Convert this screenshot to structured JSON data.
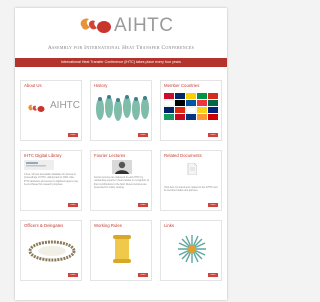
{
  "header": {
    "logo_text": "AIHTC",
    "tagline": "Assembly for International Heat Transfer Conferences",
    "banner": "International Heat Transfer Conference (IHTC) takes place every four years"
  },
  "cards": [
    {
      "title": "About Us",
      "button": "more",
      "logo_text": "AIHTC"
    },
    {
      "title": "History",
      "button": "more"
    },
    {
      "title": "Member Countries",
      "button": "more"
    },
    {
      "title": "IHTC Digital Library",
      "button": "more",
      "text": "A free, full text accessible database for access to proceedings of IHTC, dating back to 1961. Also, IHTC abstracts and access to digitized papers may be purchased for research purposes."
    },
    {
      "title": "Fourier Lectures",
      "button": "more",
      "text": "Fourier lectures are delivered at each IHTC by outstanding experts in heat transfer in recognition of their contributions to the field. Recent lectures are presented for online viewing."
    },
    {
      "title": "Related Documents",
      "button": "more",
      "text": "Click here for documents related to the AIHTC and its member bodies and partners."
    },
    {
      "title": "Officers & Delegates",
      "button": "more"
    },
    {
      "title": "Working Rules",
      "button": "more"
    },
    {
      "title": "Links",
      "button": "more"
    }
  ],
  "colors": {
    "accent": "#b3342c",
    "button": "#d0433a",
    "title": "#c43b30"
  }
}
